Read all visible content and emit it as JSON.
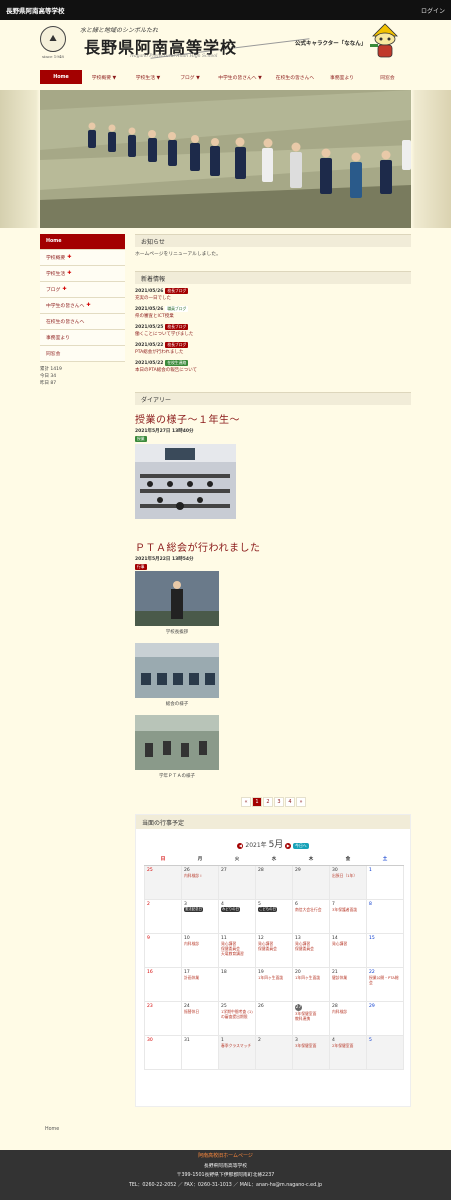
{
  "topbar": {
    "site_title": "長野県阿南高等学校",
    "login": "ログイン"
  },
  "header": {
    "catchphrase": "水と緑と地域のシンボルたれ",
    "school_name": "長野県阿南高等学校",
    "school_name_en": "Nagano Prefectural Anan High School",
    "since": "since 1948",
    "mascot_label": "公式キャラクター「ななん」"
  },
  "nav": {
    "items": [
      {
        "label": "Home"
      },
      {
        "label": "学校概要 ▼"
      },
      {
        "label": "学校生活 ▼"
      },
      {
        "label": "ブログ ▼"
      },
      {
        "label": "中学生の皆さんへ ▼"
      },
      {
        "label": "在校生の皆さんへ"
      },
      {
        "label": "事務室より"
      },
      {
        "label": "同窓会"
      }
    ]
  },
  "sidebar": {
    "items": [
      {
        "label": "Home",
        "plus": ""
      },
      {
        "label": "学校概要",
        "plus": "✚"
      },
      {
        "label": "学校生活",
        "plus": "✚"
      },
      {
        "label": "ブログ",
        "plus": "✚"
      },
      {
        "label": "中学生の皆さんへ",
        "plus": "✚"
      },
      {
        "label": "在校生の皆さんへ",
        "plus": ""
      },
      {
        "label": "事務室より",
        "plus": ""
      },
      {
        "label": "同窓会",
        "plus": ""
      }
    ],
    "counter": {
      "total": "累計 1419",
      "today": "今日 34",
      "yesterday": "昨日 87"
    }
  },
  "notice": {
    "heading": "お知らせ",
    "text": "ホームページをリニューアルしました。"
  },
  "news": {
    "heading": "新着情報",
    "items": [
      {
        "date": "2021/05/26",
        "badge": "校長ブログ",
        "badge_color": "red",
        "title": "充実の一日でした"
      },
      {
        "date": "2021/05/26",
        "badge": "職員ブログ",
        "badge_color": "gray",
        "title": "県の審査とICT授業"
      },
      {
        "date": "2021/05/25",
        "badge": "校長ブログ",
        "badge_color": "red",
        "title": "働くことについて学びました"
      },
      {
        "date": "2021/05/22",
        "badge": "校長ブログ",
        "badge_color": "red",
        "title": "PTA総会が行われました"
      },
      {
        "date": "2021/05/22",
        "badge": "在校生連絡",
        "badge_color": "green",
        "title": "本日のPTA総会の報告について"
      }
    ]
  },
  "diary": {
    "heading": "ダイアリー",
    "posts": [
      {
        "title": "授業の様子～１年生～",
        "date": "2021年5月27日 13時40分",
        "tag": "授業"
      },
      {
        "title": "ＰＴＡ総会が行われました",
        "date": "2021年5月22日 13時54分",
        "tag": "行事",
        "captions": [
          "学校長挨拶",
          "総会の様子",
          "学年ＰＴＡの様子"
        ]
      }
    ]
  },
  "pager": [
    "«",
    "1",
    "2",
    "3",
    "4",
    "»"
  ],
  "calendar": {
    "heading": "当面の行事予定",
    "year": "2021年",
    "month": "5月",
    "today_button": "今日へ",
    "weekdays": [
      "日",
      "月",
      "火",
      "水",
      "木",
      "金",
      "土"
    ],
    "weeks": [
      [
        {
          "d": "25",
          "o": true,
          "ev": []
        },
        {
          "d": "26",
          "o": true,
          "ev": [
            "内科検診 I"
          ]
        },
        {
          "d": "27",
          "o": true,
          "ev": []
        },
        {
          "d": "28",
          "o": true,
          "ev": []
        },
        {
          "d": "29",
          "o": true,
          "ev": []
        },
        {
          "d": "30",
          "o": true,
          "ev": [
            "出張日（1年）"
          ]
        },
        {
          "d": "1",
          "ev": []
        }
      ],
      [
        {
          "d": "2",
          "ev": []
        },
        {
          "d": "3",
          "ev": [
            "憲法記念日"
          ],
          "pill": true
        },
        {
          "d": "4",
          "ev": [
            "みどりの日"
          ],
          "pill": true
        },
        {
          "d": "5",
          "ev": [
            "こどもの日"
          ],
          "pill": true
        },
        {
          "d": "6",
          "ev": [
            "南信大会壮行会"
          ]
        },
        {
          "d": "7",
          "ev": [
            "3年保護者面談"
          ]
        },
        {
          "d": "8",
          "ev": []
        }
      ],
      [
        {
          "d": "9",
          "ev": []
        },
        {
          "d": "10",
          "ev": [
            "内科検診"
          ]
        },
        {
          "d": "11",
          "ev": [
            "発心講習",
            "保健委員会",
            "天竜教育講習"
          ]
        },
        {
          "d": "12",
          "ev": [
            "発心講習",
            "保健委員会"
          ]
        },
        {
          "d": "13",
          "ev": [
            "発心講習",
            "保健委員会"
          ]
        },
        {
          "d": "14",
          "ev": [
            "発心講習"
          ]
        },
        {
          "d": "15",
          "ev": []
        }
      ],
      [
        {
          "d": "16",
          "ev": []
        },
        {
          "d": "17",
          "ev": [
            "計画休業"
          ]
        },
        {
          "d": "18",
          "ev": []
        },
        {
          "d": "19",
          "ev": [
            "1年四ヶ生面談"
          ]
        },
        {
          "d": "20",
          "ev": [
            "1年四ヶ生面談"
          ]
        },
        {
          "d": "21",
          "ev": [
            "健診休業"
          ]
        },
        {
          "d": "22",
          "ev": [
            "授業公開・PTA総会"
          ]
        }
      ],
      [
        {
          "d": "23",
          "ev": []
        },
        {
          "d": "24",
          "ev": [
            "振替休日"
          ]
        },
        {
          "d": "25",
          "ev": [
            "1学期中間考査 (1)の審査提出期限"
          ]
        },
        {
          "d": "26",
          "ev": []
        },
        {
          "d": "27",
          "ev": [
            "3年保健室面",
            "教科連携"
          ],
          "today": true
        },
        {
          "d": "28",
          "ev": [
            "内科検診"
          ]
        },
        {
          "d": "29",
          "ev": []
        }
      ],
      [
        {
          "d": "30",
          "ev": []
        },
        {
          "d": "31",
          "ev": []
        },
        {
          "d": "1",
          "o": true,
          "ev": [
            "春季クラスマッチ"
          ]
        },
        {
          "d": "2",
          "o": true,
          "ev": []
        },
        {
          "d": "3",
          "o": true,
          "ev": [
            "3年保健室面"
          ]
        },
        {
          "d": "4",
          "o": true,
          "ev": [
            "2年保健室面"
          ]
        },
        {
          "d": "5",
          "o": true,
          "ev": []
        }
      ]
    ]
  },
  "breadcrumb": "Home",
  "footer": {
    "title": "阿南高校旧ホームページ",
    "name": "長野県阿南高等学校",
    "address": "〒399-1501長野県下伊那郡阿南町北條2237",
    "contact": "TEL：0260-22-2052 ／ FAX：0260-31-1013 ／ MAIL：anan-hs@m.nagano-c.ed.jp"
  },
  "colors": {
    "accent": "#a30000",
    "background": "#fffbe6",
    "footer": "#333333"
  }
}
